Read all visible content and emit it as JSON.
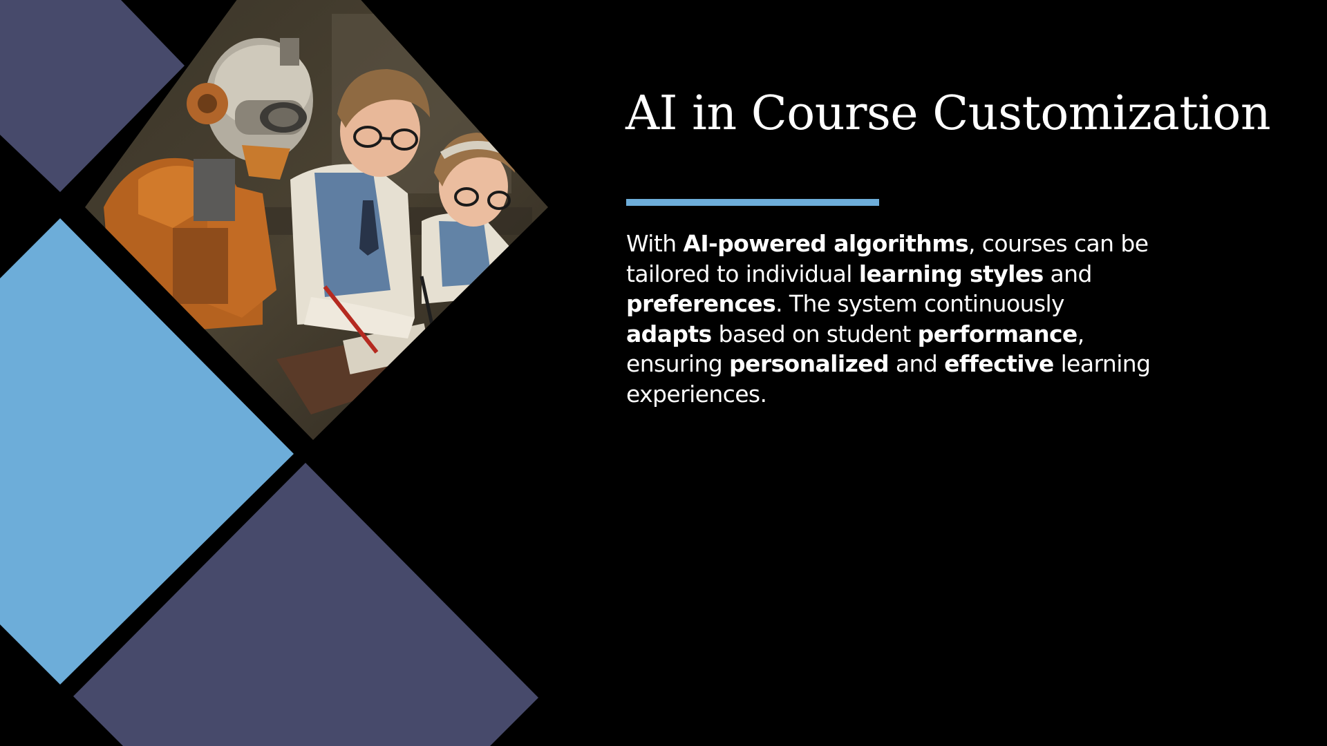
{
  "slide": {
    "title": "AI in Course Customization",
    "paragraph": [
      {
        "text": "With ",
        "bold": false
      },
      {
        "text": "AI-powered algorithms",
        "bold": true
      },
      {
        "text": ", courses can be tailored to individual ",
        "bold": false
      },
      {
        "text": "learning styles",
        "bold": true
      },
      {
        "text": " and ",
        "bold": false
      },
      {
        "text": "preferences",
        "bold": true
      },
      {
        "text": ". The system continuously ",
        "bold": false
      },
      {
        "text": "adapts",
        "bold": true
      },
      {
        "text": " based on student ",
        "bold": false
      },
      {
        "text": "performance",
        "bold": true
      },
      {
        "text": ", ensuring ",
        "bold": false
      },
      {
        "text": "personalized",
        "bold": true
      },
      {
        "text": " and ",
        "bold": false
      },
      {
        "text": "effective",
        "bold": true
      },
      {
        "text": " learning experiences.",
        "bold": false
      }
    ]
  },
  "colors": {
    "background": "#000000",
    "slate_tile": "#474A6B",
    "sky_tile": "#6DADD9",
    "accent_line": "#6DADD9",
    "text": "#FFFFFF"
  },
  "photo": {
    "icon": "robot-and-students-illustration"
  }
}
